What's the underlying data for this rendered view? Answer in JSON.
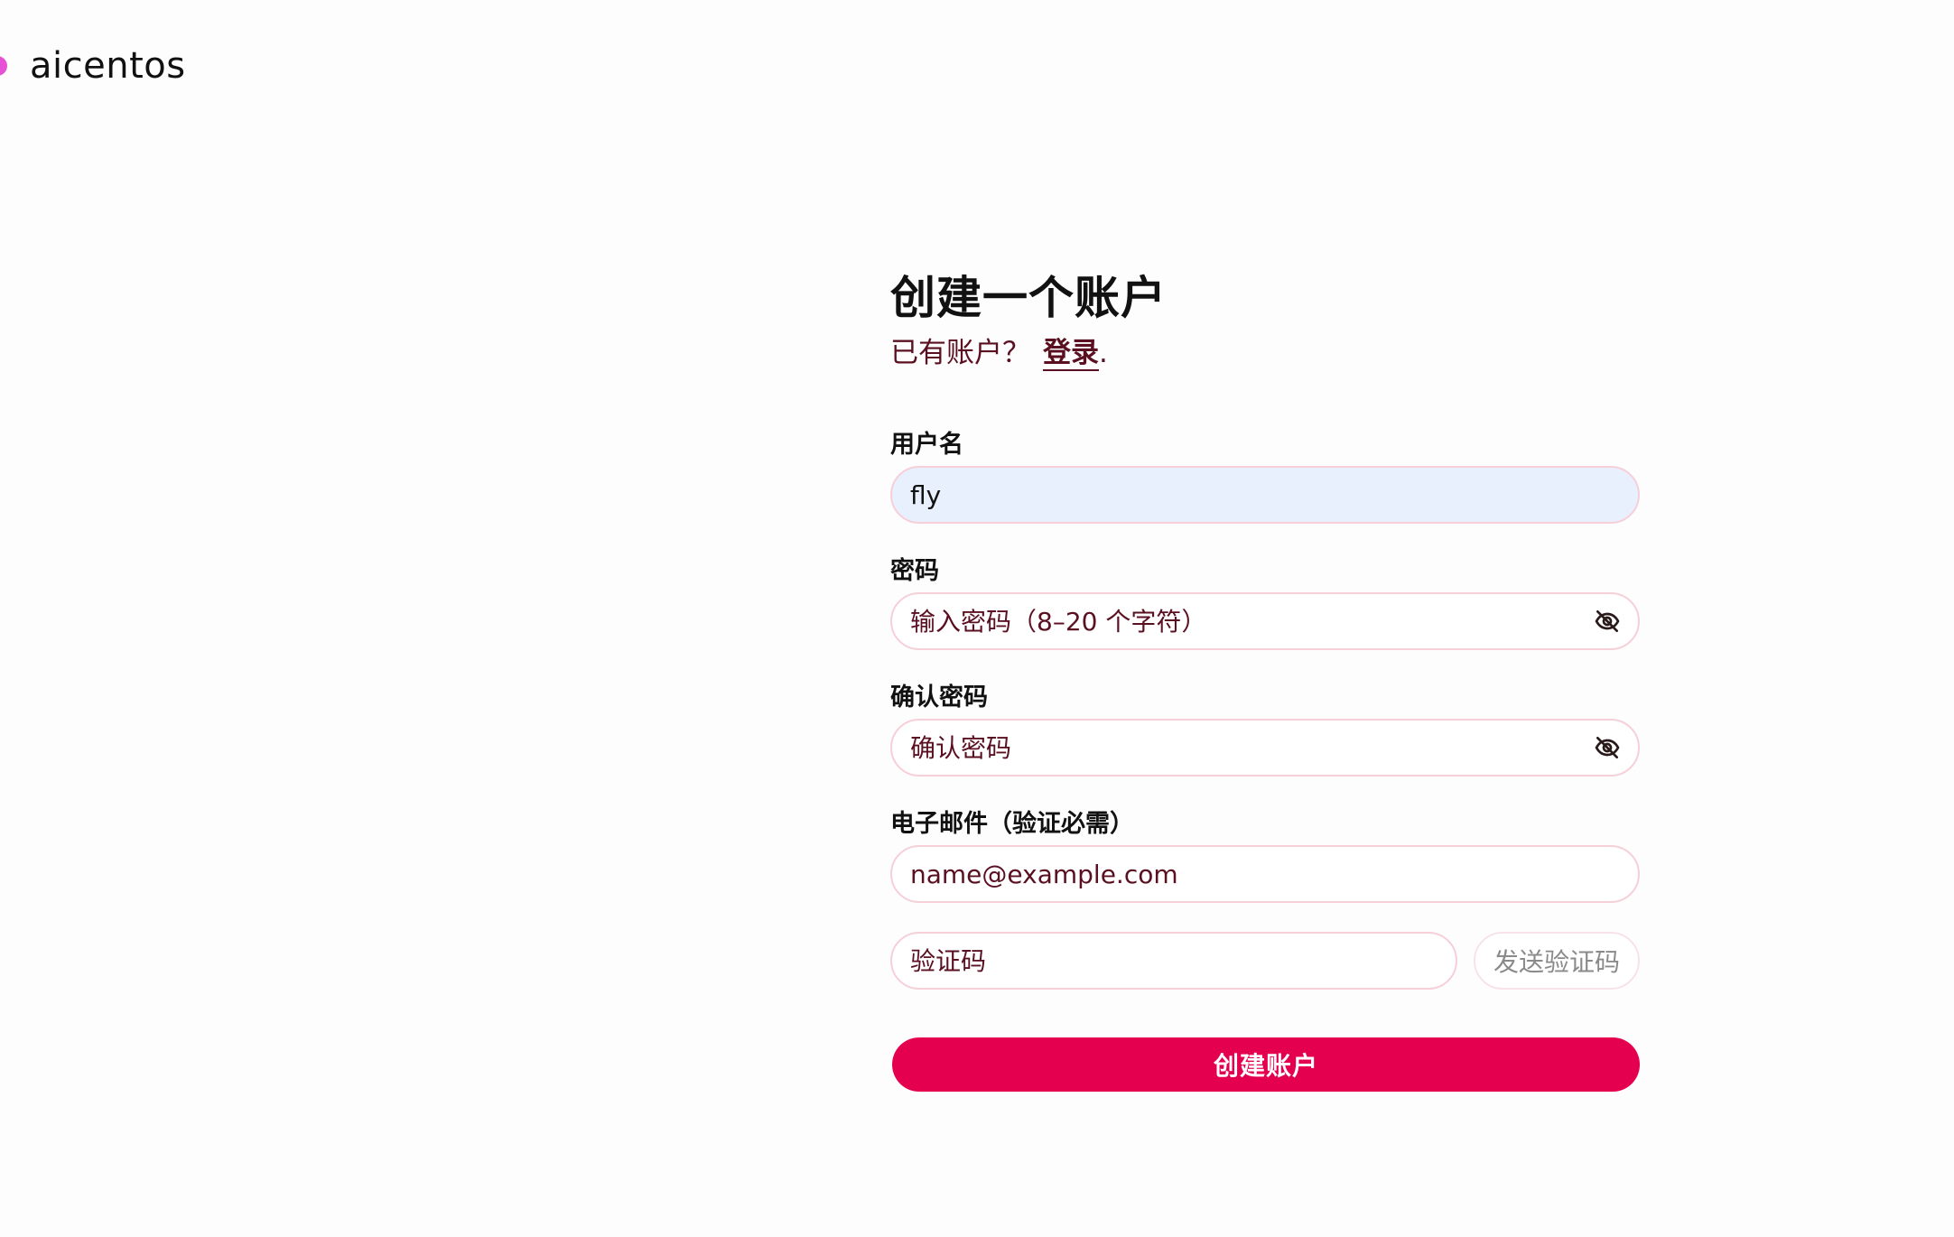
{
  "brand": {
    "name": "aicentos",
    "dot_color": "#e552d6"
  },
  "form": {
    "title": "创建一个账户",
    "subtitle_prefix": "已有账户？",
    "login_link": "登录",
    "subtitle_suffix": ".",
    "username": {
      "label": "用户名",
      "value": "fly"
    },
    "password": {
      "label": "密码",
      "placeholder": "输入密码（8–20 个字符）",
      "toggle_icon": "eye-off-icon"
    },
    "confirm_password": {
      "label": "确认密码",
      "placeholder": "确认密码",
      "toggle_icon": "eye-off-icon"
    },
    "email": {
      "label": "电子邮件（验证必需）",
      "placeholder": "name@example.com"
    },
    "verification_code": {
      "placeholder": "验证码",
      "send_button": "发送验证码"
    },
    "submit_label": "创建账户"
  },
  "colors": {
    "accent": "#e5004f",
    "link": "#5a1020",
    "input_border": "#f6cfd8",
    "autofill_bg": "#e8effd"
  }
}
